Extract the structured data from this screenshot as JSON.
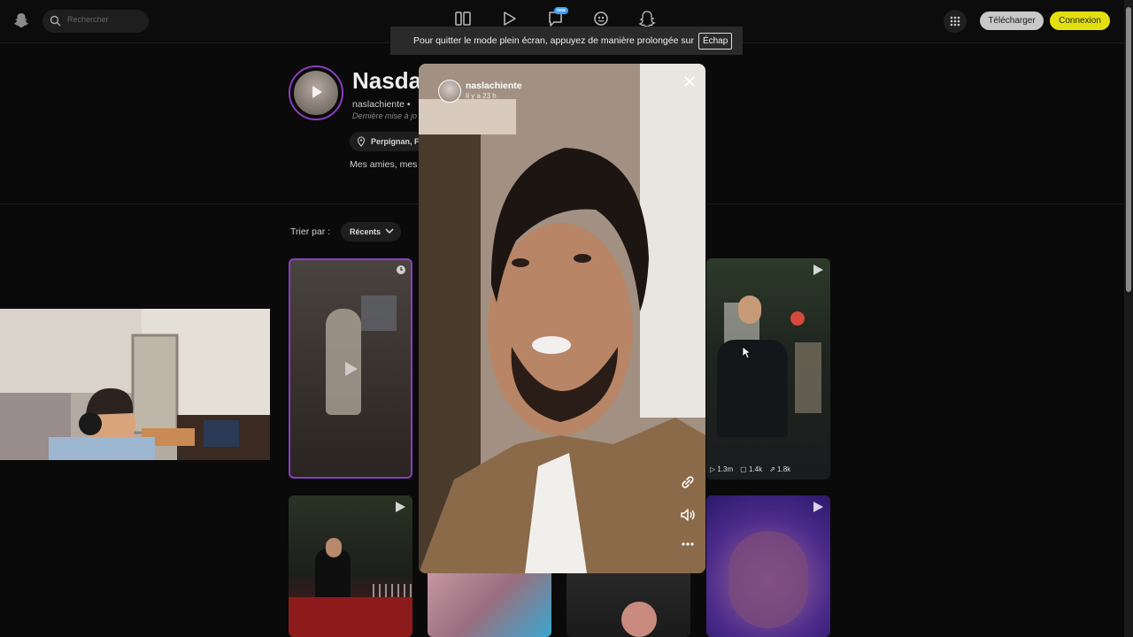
{
  "header": {
    "search_placeholder": "Rechercher",
    "nav_badge": "new",
    "download_label": "Télécharger",
    "login_label": "Connexion"
  },
  "fullscreen_toast": {
    "message": "Pour quitter le mode plein écran, appuyez de manière prolongée sur",
    "key": "Échap"
  },
  "profile": {
    "display_name": "Nasdaz",
    "username": "naslachiente •",
    "updated": "Dernière mise à jo",
    "location": "Perpignan, Fr",
    "bio": "Mes amies, mes"
  },
  "sort": {
    "label": "Trier par :",
    "selected": "Récents"
  },
  "tiles": [
    {
      "stats": {
        "views": "1.3m",
        "comments": "1.4k",
        "shares": "1.8k"
      }
    }
  ],
  "story_modal": {
    "username": "naslachiente",
    "time": "Il y a 23 h"
  },
  "colors": {
    "accent_yellow": "#e3e011",
    "story_ring": "#8a3dbf"
  }
}
